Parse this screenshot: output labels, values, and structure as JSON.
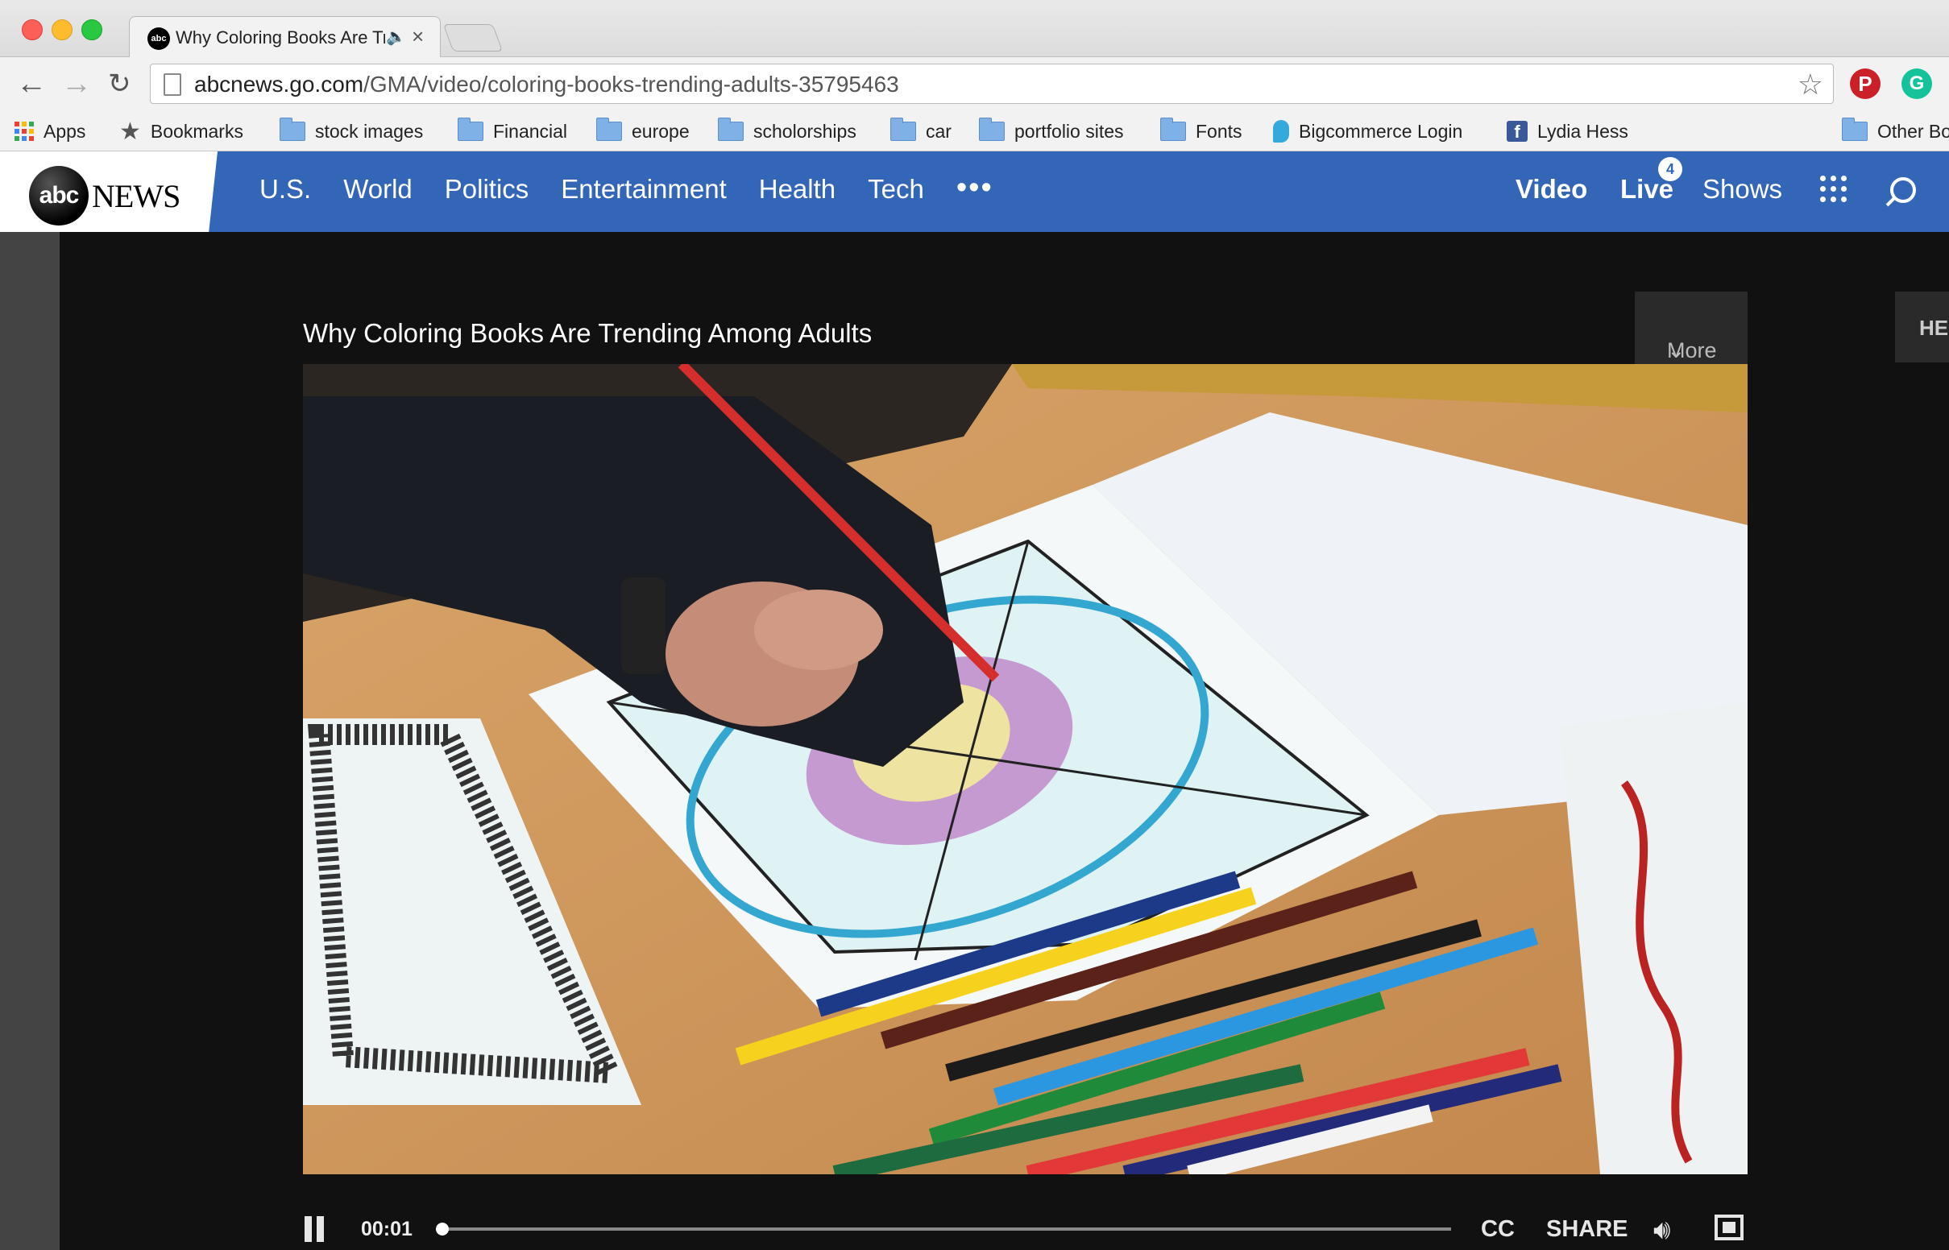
{
  "browser": {
    "tab_title": "Why Coloring Books Are Trending Among Adults",
    "tab_favicon_text": "abc",
    "url_domain": "abcnews.go.com",
    "url_path": "/GMA/video/coloring-books-trending-adults-35795463",
    "bookmarks": [
      {
        "label": "Apps",
        "icon": "apps-grid-icon"
      },
      {
        "label": "Bookmarks",
        "icon": "star-icon"
      },
      {
        "label": "stock images",
        "icon": "folder-icon"
      },
      {
        "label": "Financial",
        "icon": "folder-icon"
      },
      {
        "label": "europe",
        "icon": "folder-icon"
      },
      {
        "label": "scholorships",
        "icon": "folder-icon"
      },
      {
        "label": "car",
        "icon": "folder-icon"
      },
      {
        "label": "portfolio sites",
        "icon": "folder-icon"
      },
      {
        "label": "Fonts",
        "icon": "folder-icon"
      },
      {
        "label": "Bigcommerce Login",
        "icon": "bigcommerce-icon"
      },
      {
        "label": "Lydia Hess",
        "icon": "facebook-icon"
      },
      {
        "label": "Other Bo",
        "icon": "folder-icon"
      }
    ],
    "overflow_label": "»"
  },
  "site": {
    "logo_circle": "abc",
    "logo_word": "NEWS",
    "nav": [
      "U.S.",
      "World",
      "Politics",
      "Entertainment",
      "Health",
      "Tech"
    ],
    "more": "•••",
    "right_nav": {
      "video": "Video",
      "live": "Live",
      "live_count": "4",
      "shows": "Shows"
    },
    "brand_color": "#3466b8"
  },
  "video": {
    "title": "Why Coloring Books Are Trending Among Adults",
    "more_label": "More",
    "side_tab": "HE",
    "time": "00:01",
    "progress": 0.002,
    "cc": "CC",
    "share": "SHARE"
  }
}
